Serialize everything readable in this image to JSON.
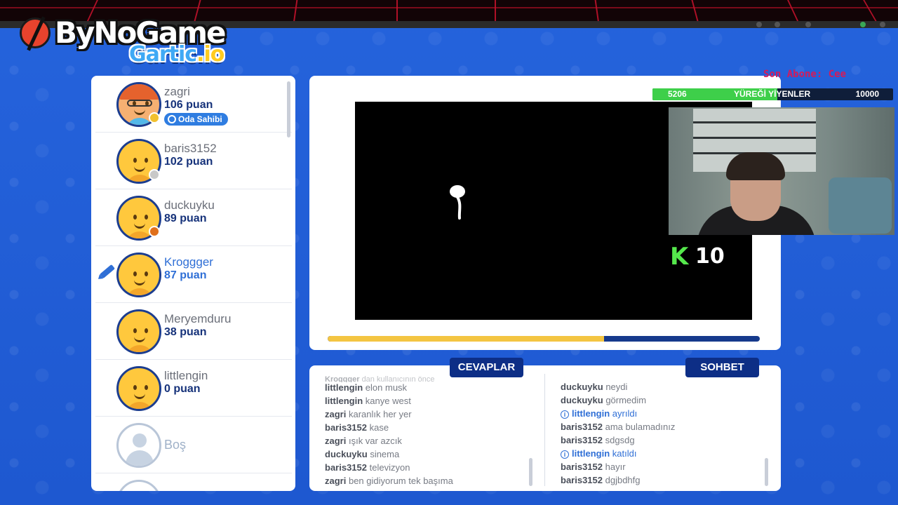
{
  "branding": {
    "stream_logo": "ByNoGame",
    "game_logo_main": "Gartic",
    "game_logo_suffix": ".io"
  },
  "players": [
    {
      "name": "zagri",
      "score": "106 puan",
      "badge": "Oda Sahibi",
      "status_color": "#f2c12e",
      "avatar": "owner"
    },
    {
      "name": "baris3152",
      "score": "102 puan",
      "status_color": "#c8c8c8",
      "avatar": "default"
    },
    {
      "name": "duckuyku",
      "score": "89 puan",
      "status_color": "#e0701c",
      "avatar": "default"
    },
    {
      "name": "Kroggger",
      "score": "87 puan",
      "drawing": true,
      "avatar": "default"
    },
    {
      "name": "Meryemduru",
      "score": "38 puan",
      "avatar": "default"
    },
    {
      "name": "littlengin",
      "score": "0 puan",
      "avatar": "default"
    },
    {
      "name": "Boş",
      "avatar": "empty"
    }
  ],
  "canvas": {
    "timer_fraction": 0.64,
    "colors": {
      "background": "#000000",
      "stroke": "#ffffff",
      "timer_fill": "#f4c542",
      "timer_track": "#163a8c"
    }
  },
  "stream_overlay": {
    "sub_ticker": "Son Abone: Cee",
    "goal_current": "5206",
    "goal_title": "YÜREĞİ YİYENLER",
    "goal_target": "10000",
    "goal_fraction": 0.52,
    "k_counter_icon": "K",
    "k_counter_value": "10"
  },
  "answers": {
    "tab_label": "CEVAPLAR",
    "faded_line": {
      "user": "Kroggger",
      "text": "dan kullanıcının önce"
    },
    "messages": [
      {
        "user": "littlengin",
        "text": "elon musk"
      },
      {
        "user": "littlengin",
        "text": "kanye west"
      },
      {
        "user": "zagri",
        "text": "karanlık her yer"
      },
      {
        "user": "baris3152",
        "text": "kase"
      },
      {
        "user": "zagri",
        "text": "ışık var azcık"
      },
      {
        "user": "duckuyku",
        "text": "sinema"
      },
      {
        "user": "baris3152",
        "text": "televizyon"
      },
      {
        "user": "zagri",
        "text": "ben gidiyorum tek başıma"
      }
    ]
  },
  "chat": {
    "tab_label": "SOHBET",
    "messages": [
      {
        "user": "duckuyku",
        "text": "neydi"
      },
      {
        "user": "duckuyku",
        "text": "görmedim"
      },
      {
        "system": true,
        "user": "littlengin",
        "text": "ayrıldı",
        "icon": "info-icon"
      },
      {
        "user": "baris3152",
        "text": "ama bulamadınız"
      },
      {
        "user": "baris3152",
        "text": "sdgsdg"
      },
      {
        "system": true,
        "user": "littlengin",
        "text": "katıldı",
        "icon": "info-icon"
      },
      {
        "user": "baris3152",
        "text": "hayır"
      },
      {
        "user": "baris3152",
        "text": "dgjbdhfg"
      }
    ]
  }
}
